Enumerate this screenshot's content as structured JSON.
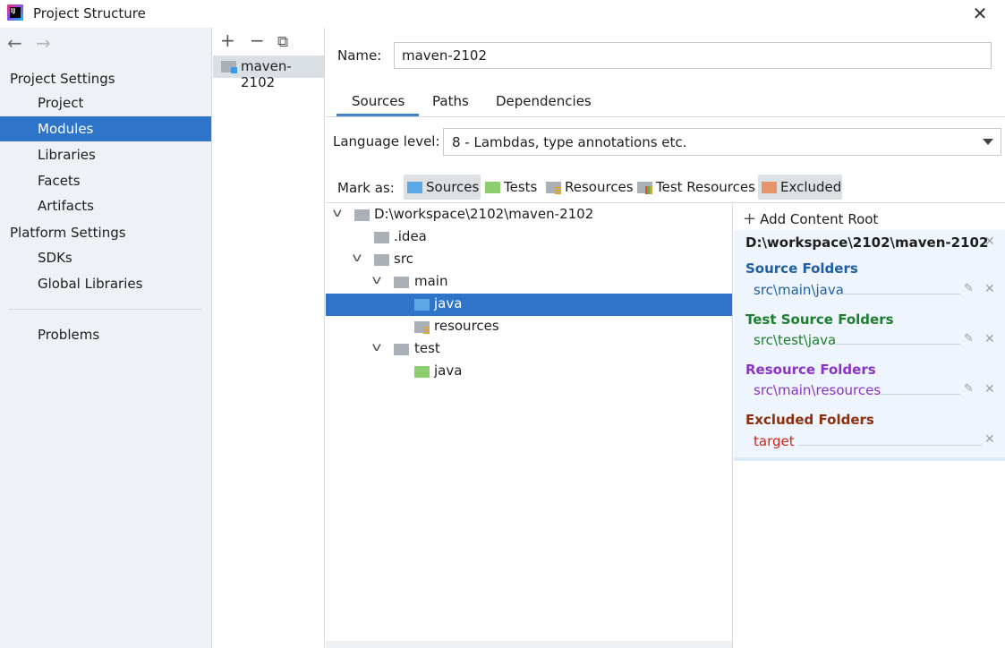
{
  "window": {
    "title": "Project Structure",
    "close_glyph": "✕"
  },
  "nav": {
    "back_glyph": "←",
    "forward_glyph": "→"
  },
  "sidebar": {
    "project_settings_header": "Project Settings",
    "project_items": [
      "Project",
      "Modules",
      "Libraries",
      "Facets",
      "Artifacts"
    ],
    "platform_settings_header": "Platform Settings",
    "platform_items": [
      "SDKs",
      "Global Libraries"
    ],
    "problems_label": "Problems",
    "selected": "Modules"
  },
  "modules": {
    "toolbar": {
      "add_glyph": "+",
      "remove_glyph": "−",
      "copy_glyph": "⧉"
    },
    "items": [
      "maven-2102"
    ]
  },
  "main": {
    "name_label": "Name:",
    "name_value": "maven-2102",
    "tabs": [
      "Sources",
      "Paths",
      "Dependencies"
    ],
    "active_tab": "Sources",
    "language_label": "Language level:",
    "language_value": "8 - Lambdas, type annotations etc.",
    "mark_as_label": "Mark as:",
    "mark_buttons": [
      "Sources",
      "Tests",
      "Resources",
      "Test Resources",
      "Excluded"
    ]
  },
  "tree": {
    "rows": [
      {
        "label": "D:\\workspace\\2102\\maven-2102",
        "expanded": true
      },
      {
        "label": ".idea"
      },
      {
        "label": "src",
        "expanded": true
      },
      {
        "label": "main",
        "expanded": true
      },
      {
        "label": "java",
        "selected": true
      },
      {
        "label": "resources"
      },
      {
        "label": "test",
        "expanded": true
      },
      {
        "label": "java"
      }
    ],
    "chevron_glyph": "v"
  },
  "roots": {
    "add_label": "Add Content Root",
    "add_glyph": "+",
    "root_path": "D:\\workspace\\2102\\maven-2102",
    "remove_glyph": "✕",
    "edit_glyph": "✎",
    "source_title": "Source Folders",
    "source_path": "src\\main\\java",
    "test_title": "Test Source Folders",
    "test_path": "src\\test\\java",
    "resource_title": "Resource Folders",
    "resource_path": "src\\main\\resources",
    "excluded_title": "Excluded Folders",
    "excluded_path": "target"
  },
  "colors": {
    "selection": "#2e74c8",
    "sources": "#1f5fa5",
    "tests": "#1d7f2e",
    "resources": "#8a33c9",
    "excluded": "#8b2f0e",
    "excluded_path": "#c9261b"
  }
}
